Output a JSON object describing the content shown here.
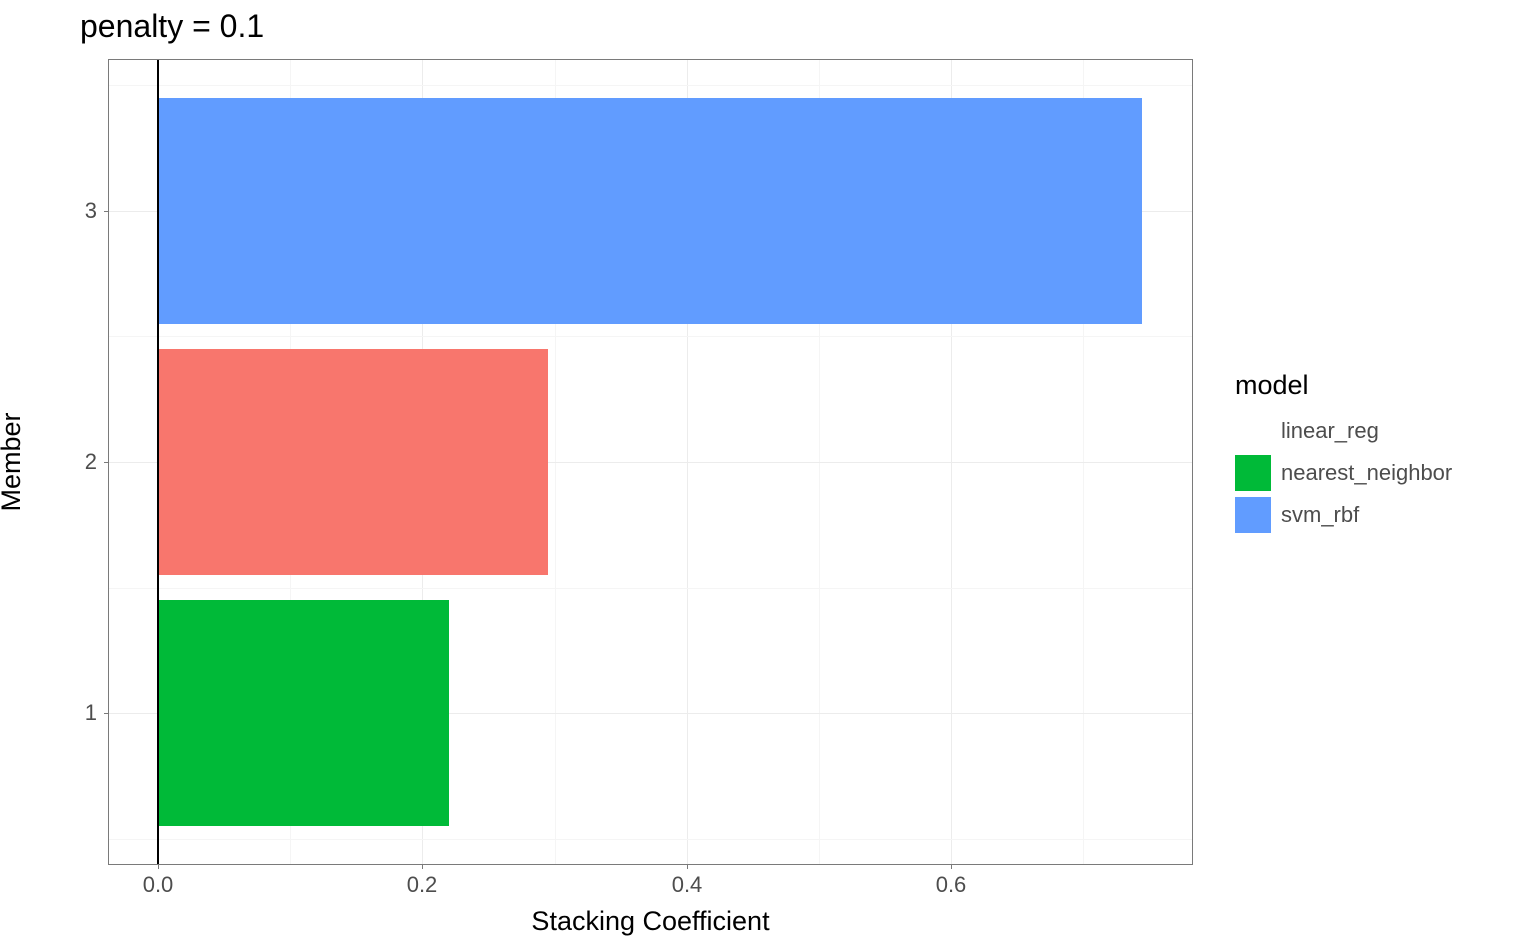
{
  "chart_data": {
    "type": "bar",
    "orientation": "horizontal",
    "title": "penalty = 0.1",
    "xlabel": "Stacking Coefficient",
    "ylabel": "Member",
    "xlim": [
      0,
      0.8
    ],
    "x_ticks": [
      0.0,
      0.2,
      0.4,
      0.6
    ],
    "x_tick_labels": [
      "0.0",
      "0.2",
      "0.4",
      "0.6"
    ],
    "y_ticks": [
      1,
      2,
      3
    ],
    "y_tick_labels": [
      "1",
      "2",
      "3"
    ],
    "series": [
      {
        "member": 1,
        "model": "nearest_neighbor",
        "value": 0.22,
        "color": "#00ba38"
      },
      {
        "member": 2,
        "model": "linear_reg",
        "value": 0.295,
        "color": "#f8766d"
      },
      {
        "member": 3,
        "model": "svm_rbf",
        "value": 0.745,
        "color": "#619cff"
      }
    ],
    "legend_title": "model",
    "legend": [
      {
        "name": "linear_reg",
        "color": "#f8766d"
      },
      {
        "name": "nearest_neighbor",
        "color": "#00ba38"
      },
      {
        "name": "svm_rbf",
        "color": "#619cff"
      }
    ]
  }
}
